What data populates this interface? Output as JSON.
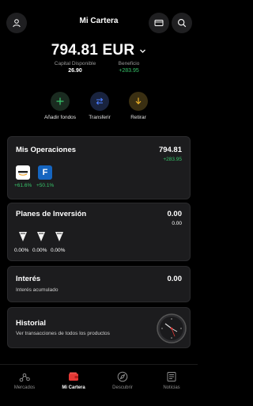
{
  "header": {
    "title": "Mi Cartera",
    "icons": [
      "profile-icon",
      "card-icon",
      "search-icon"
    ]
  },
  "balance": {
    "amount": "794.81 EUR",
    "capital_label": "Capital Disponible",
    "capital_value": "26.90",
    "benefit_label": "Beneficio",
    "benefit_value": "+283.95"
  },
  "actions": [
    {
      "label": "Añadir fondos",
      "icon": "plus-icon",
      "color": "#37c46a"
    },
    {
      "label": "Transferir",
      "icon": "transfer-icon",
      "color": "#4a7cff"
    },
    {
      "label": "Retirar",
      "icon": "withdraw-icon",
      "color": "#f0b429"
    }
  ],
  "operations": {
    "title": "Mis Operaciones",
    "value": "794.81",
    "change": "+283.95",
    "assets": [
      {
        "icon": "amazon-logo-icon",
        "change": "+61.6%"
      },
      {
        "logo_text": "F",
        "icon": "f-logo-icon",
        "change": "+50.1%"
      }
    ]
  },
  "plans": {
    "title": "Planes de Inversión",
    "value": "0.00",
    "sub_value": "0.00",
    "items": [
      {
        "pct": "0.00%"
      },
      {
        "pct": "0.00%"
      },
      {
        "pct": "0.00%"
      }
    ]
  },
  "interest": {
    "title": "Interés",
    "value": "0.00",
    "subtitle": "Interés acumulado"
  },
  "history": {
    "title": "Historial",
    "subtitle": "Ver transacciones de todos los productos"
  },
  "tabs": [
    {
      "label": "Mercados",
      "icon": "markets-icon",
      "active": false
    },
    {
      "label": "Mi Cartera",
      "icon": "wallet-icon",
      "active": true
    },
    {
      "label": "Descubrir",
      "icon": "compass-icon",
      "active": false
    },
    {
      "label": "Noticias",
      "icon": "news-icon",
      "active": false
    }
  ],
  "colors": {
    "accent_green": "#37c46a",
    "accent_red": "#e53935",
    "card_bg": "#1c1c1e"
  }
}
